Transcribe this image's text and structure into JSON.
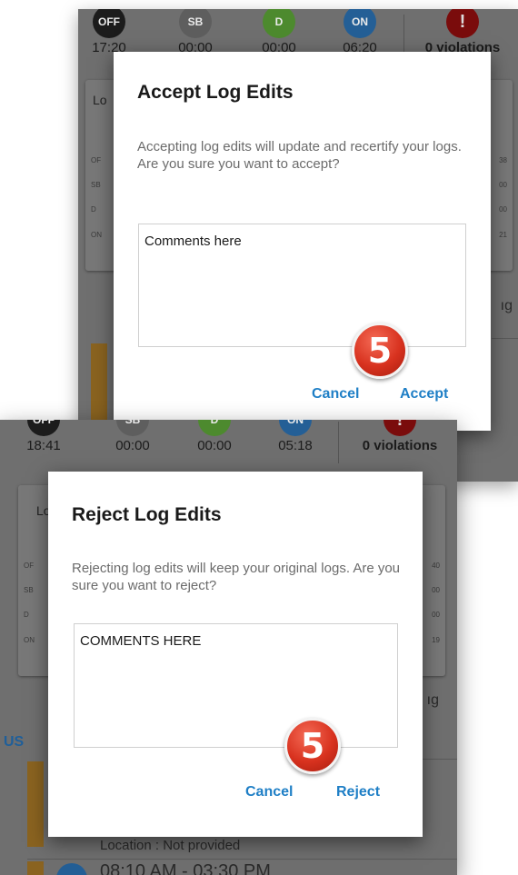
{
  "top": {
    "status": [
      {
        "code": "OFF",
        "time": "17:20",
        "color": "#1c1c1c"
      },
      {
        "code": "SB",
        "time": "00:00",
        "color": "#5e5e5e"
      },
      {
        "code": "D",
        "time": "00:00",
        "color": "#4d8a2e"
      },
      {
        "code": "ON",
        "time": "06:20",
        "color": "#245f96"
      }
    ],
    "violation_icon": "!",
    "violations": "0 violations",
    "log_title_fragment": "Lo",
    "log_rows": [
      {
        "label": "OF",
        "value": "38"
      },
      {
        "label": "SB",
        "value": "00"
      },
      {
        "label": "D",
        "value": "00"
      },
      {
        "label": "ON",
        "value": "21"
      }
    ],
    "side_fragment": "ıg",
    "dialog": {
      "title": "Accept Log Edits",
      "message": "Accepting log edits will update and recertify your logs. Are you sure you want to accept?",
      "comment": "Comments here",
      "cancel": "Cancel",
      "confirm": "Accept",
      "step": "5"
    }
  },
  "bottom": {
    "status": [
      {
        "code": "OFF",
        "time": "18:41",
        "color": "#1c1c1c"
      },
      {
        "code": "SB",
        "time": "00:00",
        "color": "#5e5e5e"
      },
      {
        "code": "D",
        "time": "00:00",
        "color": "#4d8a2e"
      },
      {
        "code": "ON",
        "time": "05:18",
        "color": "#245f96"
      }
    ],
    "violation_icon": "!",
    "violations": "0 violations",
    "log_title_fragment": "Lo",
    "log_rows": [
      {
        "label": "OF",
        "value": "40"
      },
      {
        "label": "SB",
        "value": "00"
      },
      {
        "label": "D",
        "value": "00"
      },
      {
        "label": "ON",
        "value": "19"
      }
    ],
    "side_fragment": "ıg",
    "section_fragment": "US",
    "location_fragment": "Location : Not provided",
    "time_range_fragment": "08:10 AM - 03:30 PM",
    "dialog": {
      "title": "Reject Log Edits",
      "message": "Rejecting log edits will keep your original logs. Are you sure you want to reject?",
      "comment": "COMMENTS HERE",
      "cancel": "Cancel",
      "confirm": "Reject",
      "step": "5"
    }
  }
}
